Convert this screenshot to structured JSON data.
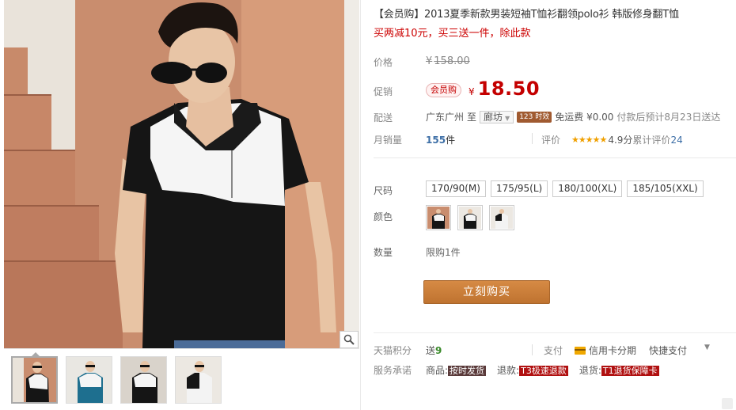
{
  "product": {
    "title": "【会员购】2013夏季新款男装短袖T恤衫翻领polo衫 韩版修身翻T恤",
    "subtitle": "买两减10元，买三送一件，除此款"
  },
  "price": {
    "label": "价格",
    "currency": "¥",
    "original": "158.00"
  },
  "promo": {
    "label": "促销",
    "badge": "会员购",
    "currency": "¥",
    "price": "18.50"
  },
  "shipping": {
    "label": "配送",
    "from": "广东广州",
    "to_word": "至",
    "destination": "廊坊",
    "tag": "123 时效",
    "freight": "免运费 ¥0.00",
    "eta": "付款后预计8月23日送达"
  },
  "sales": {
    "label": "月销量",
    "count": "155",
    "unit": "件"
  },
  "review": {
    "label": "评价",
    "stars": "★★★★★",
    "score": "4.9分",
    "total_label": "累计评价",
    "total": "24"
  },
  "size": {
    "label": "尺码",
    "options": [
      "170/90(M)",
      "175/95(L)",
      "180/100(XL)",
      "185/105(XXL)"
    ]
  },
  "color": {
    "label": "颜色"
  },
  "quantity": {
    "label": "数量",
    "limit": "限购1件"
  },
  "buy_button": "立刻购买",
  "tmall": {
    "points_label": "天猫积分",
    "give": "送",
    "points": "9",
    "pay_label": "支付",
    "credit": "信用卡分期",
    "quick": "快捷支付",
    "more": "▼"
  },
  "service": {
    "label": "服务承诺",
    "item1_prefix": "商品:",
    "item1_tag": "按时发货",
    "item2_prefix": "退款:",
    "item2_tag": "T3极速退款",
    "item3_prefix": "退货:",
    "item3_tag": "T1退货保障卡"
  },
  "colors": {
    "accent_red": "#c40000",
    "buy_button": "#c97f38",
    "link_blue": "#3c6ea6",
    "star_orange": "#f0a000"
  }
}
